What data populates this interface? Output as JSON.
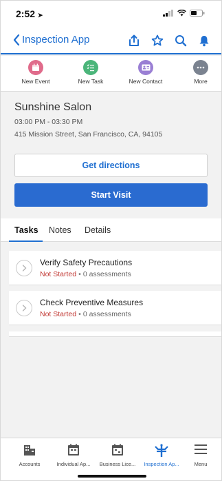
{
  "status_bar": {
    "time": "2:52"
  },
  "nav": {
    "title": "Inspection App",
    "actions": [
      "share-icon",
      "star-icon",
      "search-icon",
      "bell-icon"
    ]
  },
  "quick_actions": [
    {
      "label": "New Event",
      "icon": "calendar-icon",
      "color": "#e06b8b"
    },
    {
      "label": "New Task",
      "icon": "task-list-icon",
      "color": "#4bb57a"
    },
    {
      "label": "New Contact",
      "icon": "contact-card-icon",
      "color": "#9a7fd4"
    },
    {
      "label": "More",
      "icon": "more-icon",
      "color": "#7b8390"
    }
  ],
  "record": {
    "name": "Sunshine Salon",
    "time": "03:00 PM - 03:30 PM",
    "address": "415 Mission Street, San Francisco, CA, 94105"
  },
  "buttons": {
    "directions": "Get directions",
    "start_visit": "Start Visit"
  },
  "tabs": [
    {
      "label": "Tasks",
      "active": true
    },
    {
      "label": "Notes",
      "active": false
    },
    {
      "label": "Details",
      "active": false
    }
  ],
  "tasks": [
    {
      "title": "Verify Safety Precautions",
      "status": "Not Started",
      "separator": "•",
      "count": "0 assessments"
    },
    {
      "title": "Check Preventive Measures",
      "status": "Not Started",
      "separator": "•",
      "count": "0 assessments"
    }
  ],
  "bottom_nav": [
    {
      "label": "Accounts",
      "icon": "accounts-icon",
      "active": false
    },
    {
      "label": "Individual Ap...",
      "icon": "individual-app-icon",
      "active": false
    },
    {
      "label": "Business Lice...",
      "icon": "business-license-icon",
      "active": false
    },
    {
      "label": "Inspection Ap...",
      "icon": "inspection-app-icon",
      "active": true
    },
    {
      "label": "Menu",
      "icon": "menu-icon",
      "active": false
    }
  ],
  "colors": {
    "accent": "#1f6fd1",
    "primary_button": "#2a6bd0",
    "status_not_started": "#c23934"
  }
}
